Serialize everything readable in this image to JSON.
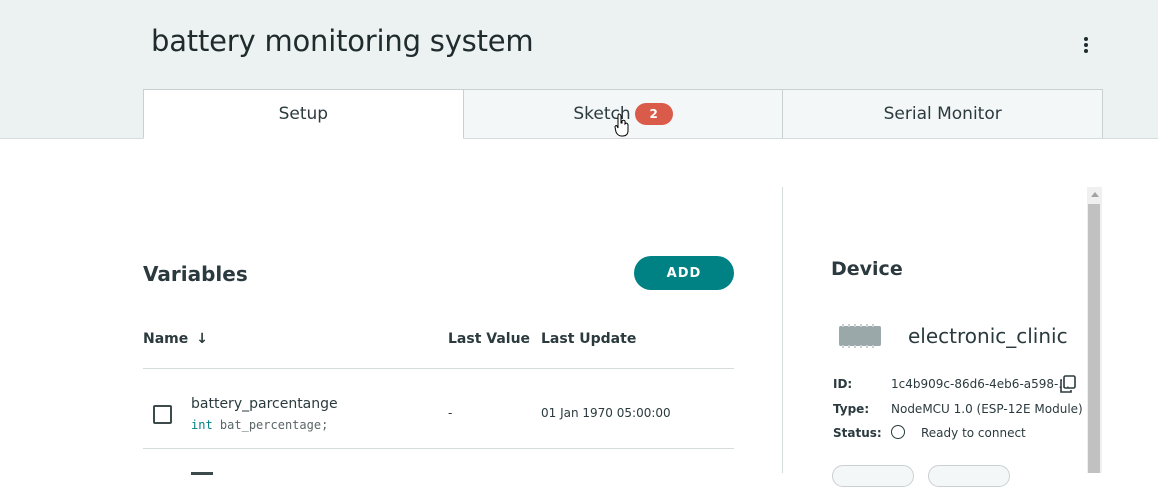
{
  "header": {
    "title": "battery monitoring system",
    "menu_icon": "kebab-vertical-icon"
  },
  "tabs": [
    {
      "label": "Setup",
      "active": true
    },
    {
      "label": "Sketch",
      "badge": "2"
    },
    {
      "label": "Serial Monitor"
    }
  ],
  "variables": {
    "title": "Variables",
    "add_label": "ADD",
    "columns": {
      "name": "Name",
      "last_value": "Last Value",
      "last_update": "Last Update"
    },
    "sort_icon": "arrow-down-icon",
    "rows": [
      {
        "name": "battery_parcentange",
        "type_keyword": "int",
        "declaration": "bat_percentage;",
        "last_value": "-",
        "last_update": "01 Jan 1970 05:00:00"
      }
    ]
  },
  "device": {
    "title": "Device",
    "name": "electronic_clinic",
    "id_label": "ID:",
    "id_value": "1c4b909c-86d6-4eb6-a598-...",
    "type_label": "Type:",
    "type_value": "NodeMCU 1.0 (ESP-12E Module)",
    "status_label": "Status:",
    "status_value": "Ready to connect"
  },
  "colors": {
    "accent": "#008184",
    "badge": "#da5b4a",
    "header_bg": "#ecf1f1"
  }
}
